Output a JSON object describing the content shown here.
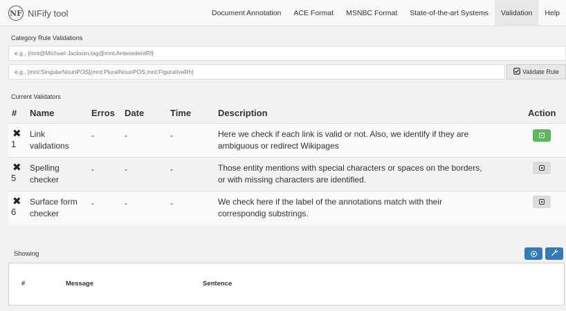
{
  "brand": {
    "logo_text": "NF",
    "name": "NIFify tool"
  },
  "nav": {
    "items": [
      {
        "label": "Document Annotation",
        "active": false
      },
      {
        "label": "ACE Format",
        "active": false
      },
      {
        "label": "MSNBC Format",
        "active": false
      },
      {
        "label": "State-of-the-art Systems",
        "active": false
      },
      {
        "label": "Validation",
        "active": true
      },
      {
        "label": "Help",
        "active": false
      }
    ]
  },
  "rules": {
    "title": "Category Rule Validations",
    "category_placeholder": "e.g., {mnt@Michael Jackson,tag@mnt:AntecedentRf}",
    "rule_placeholder": "e.g., [mnt:SingularNounPOS](mnt:PluralNounPOS,mnt:FigurativeRh)",
    "validate_label": "Validate Rule",
    "validate_icon": "check-square-icon"
  },
  "validators": {
    "title": "Current Validators",
    "headers": {
      "num": "#",
      "name": "Name",
      "errors": "Erros",
      "date": "Date",
      "time": "Time",
      "description": "Description",
      "action": "Action"
    },
    "rows": [
      {
        "num": "1",
        "name_line1": "Link",
        "name_line2": "validations",
        "errors": "-",
        "date": "-",
        "time": "-",
        "desc_line1": "Here we check if each link is valid or not. Also, we identify if they are",
        "desc_line2": "ambiguous or redirect Wikipages",
        "action_style": "green"
      },
      {
        "num": "5",
        "name_line1": "Spelling",
        "name_line2": "checker",
        "errors": "-",
        "date": "-",
        "time": "-",
        "desc_line1": "Those entity mentions with special characters or spaces on the borders,",
        "desc_line2": "or with missing characters are identified.",
        "action_style": "grey"
      },
      {
        "num": "6",
        "name_line1": "Surface form",
        "name_line2": "checker",
        "errors": "-",
        "date": "-",
        "time": "-",
        "desc_line1": "We check here if the label of the annotations match with their",
        "desc_line2": "correspondig substrings.",
        "action_style": "grey"
      }
    ]
  },
  "showing": {
    "label": "Showing",
    "columns": {
      "num": "#",
      "message": "Message",
      "sentence": "Sentence"
    }
  },
  "colors": {
    "green": "#5cb85c",
    "blue": "#337ab7",
    "grey_btn": "#dcdcdc"
  }
}
